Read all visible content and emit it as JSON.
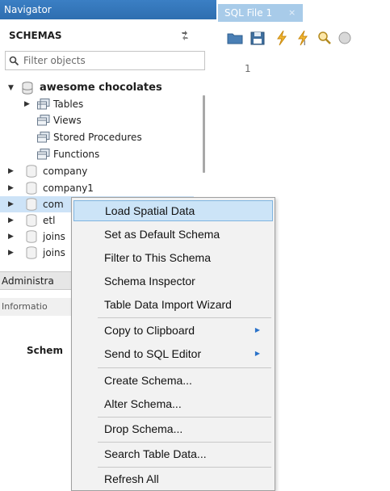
{
  "navigator": {
    "title": "Navigator",
    "schemas_header": "SCHEMAS",
    "filter_placeholder": "Filter objects",
    "tree": {
      "awesome": "awesome chocolates",
      "tables": "Tables",
      "views": "Views",
      "procedures": "Stored Procedures",
      "functions": "Functions",
      "company": "company",
      "company1": "company1",
      "com_trunc": "com",
      "etl": "etl",
      "joins1": "joins",
      "joins2": "joins"
    },
    "admin_tab": "Administra",
    "info_tab": "Informatio",
    "schema_label": "Schem"
  },
  "editor": {
    "tab_title": "SQL File 1",
    "tab_close": "×",
    "line_number": "1"
  },
  "context_menu": {
    "load_spatial": "Load Spatial Data",
    "set_default": "Set as Default Schema",
    "filter_schema": "Filter to This Schema",
    "inspector": "Schema Inspector",
    "import_wizard": "Table Data Import Wizard",
    "copy_clipboard": "Copy to Clipboard",
    "send_sql": "Send to SQL Editor",
    "create": "Create Schema...",
    "alter": "Alter Schema...",
    "drop": "Drop Schema...",
    "search": "Search Table Data...",
    "refresh": "Refresh All",
    "submenu_arrow": "▶"
  },
  "colors": {
    "accent": "#2e6eb0",
    "highlight": "#cce4f7",
    "tab_bg": "#a8cbe9"
  }
}
